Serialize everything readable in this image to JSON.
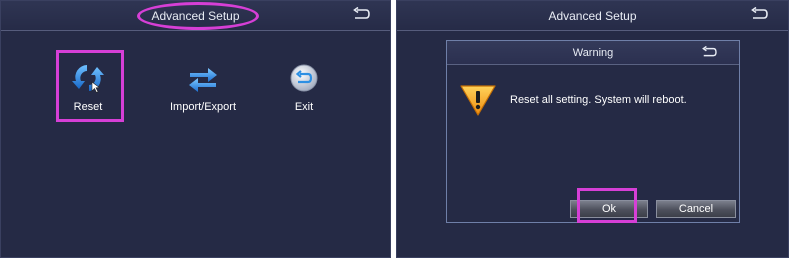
{
  "screen_left": {
    "title": "Advanced Setup",
    "menu": [
      {
        "label": "Reset",
        "icon": "refresh-arrows-icon"
      },
      {
        "label": "Import/Export",
        "icon": "swap-arrows-icon"
      },
      {
        "label": "Exit",
        "icon": "exit-icon"
      }
    ]
  },
  "screen_right": {
    "title": "Advanced Setup",
    "dialog": {
      "title": "Warning",
      "message": "Reset all setting. System will reboot.",
      "ok_label": "Ok",
      "cancel_label": "Cancel",
      "icon": "warning-icon"
    }
  },
  "colors": {
    "background": "#252a45",
    "highlight": "#d63fd6",
    "icon_blue": "#2d8fe3",
    "warning_orange": "#f5a21b"
  }
}
